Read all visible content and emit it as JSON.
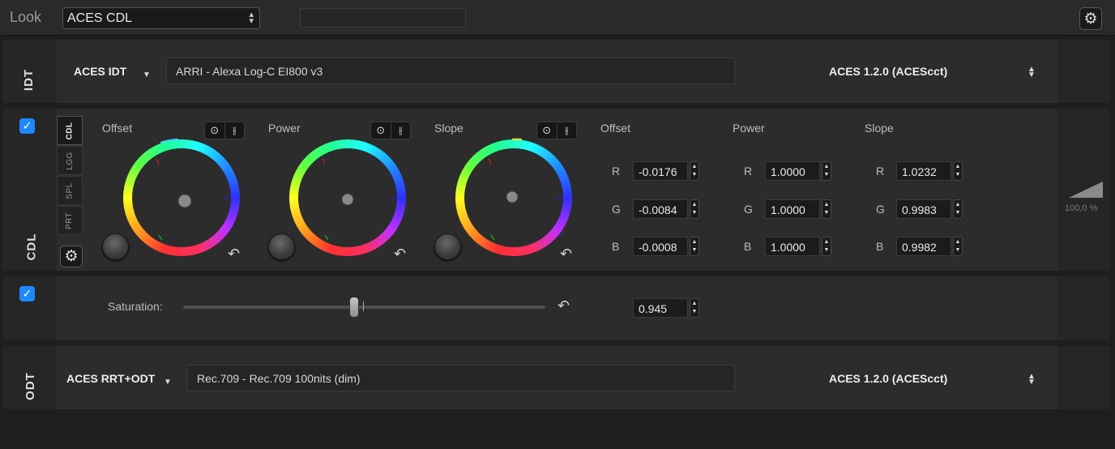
{
  "top": {
    "label": "Look",
    "look_value": "ACES CDL",
    "extra_field_value": ""
  },
  "idt": {
    "side_label": "IDT",
    "transform_label": "ACES IDT",
    "path": "ARRI - Alexa Log-C EI800 v3",
    "aces_version": "ACES 1.2.0 (ACEScct)"
  },
  "cdl": {
    "side_label": "CDL",
    "enabled": true,
    "tabs": [
      "CDL",
      "LGG",
      "SPL",
      "PRT"
    ],
    "active_tab": "CDL",
    "wheels": [
      {
        "label": "Offset"
      },
      {
        "label": "Power"
      },
      {
        "label": "Slope"
      }
    ],
    "columns": [
      {
        "header": "Offset",
        "rows": [
          {
            "channel": "R",
            "value": "-0.0176"
          },
          {
            "channel": "G",
            "value": "-0.0084"
          },
          {
            "channel": "B",
            "value": "-0.0008"
          }
        ]
      },
      {
        "header": "Power",
        "rows": [
          {
            "channel": "R",
            "value": "1.0000"
          },
          {
            "channel": "G",
            "value": "1.0000"
          },
          {
            "channel": "B",
            "value": "1.0000"
          }
        ]
      },
      {
        "header": "Slope",
        "rows": [
          {
            "channel": "R",
            "value": "1.0232"
          },
          {
            "channel": "G",
            "value": "0.9983"
          },
          {
            "channel": "B",
            "value": "0.9982"
          }
        ]
      }
    ],
    "strength": "100,0 %"
  },
  "saturation": {
    "enabled": true,
    "label": "Saturation:",
    "value": "0.945"
  },
  "odt": {
    "side_label": "ODT",
    "transform_label": "ACES RRT+ODT",
    "path": "Rec.709 - Rec.709 100nits (dim)",
    "aces_version": "ACES 1.2.0 (ACEScct)"
  },
  "icons": {
    "gear": "gear-icon",
    "checkmark": "checkmark-icon",
    "reset": "undo-arrow-icon",
    "target": "target-icon",
    "sliders": "sliders-icon"
  },
  "colors": {
    "accent_blue": "#1e88ff",
    "panel_bg": "#2c2c2c"
  }
}
